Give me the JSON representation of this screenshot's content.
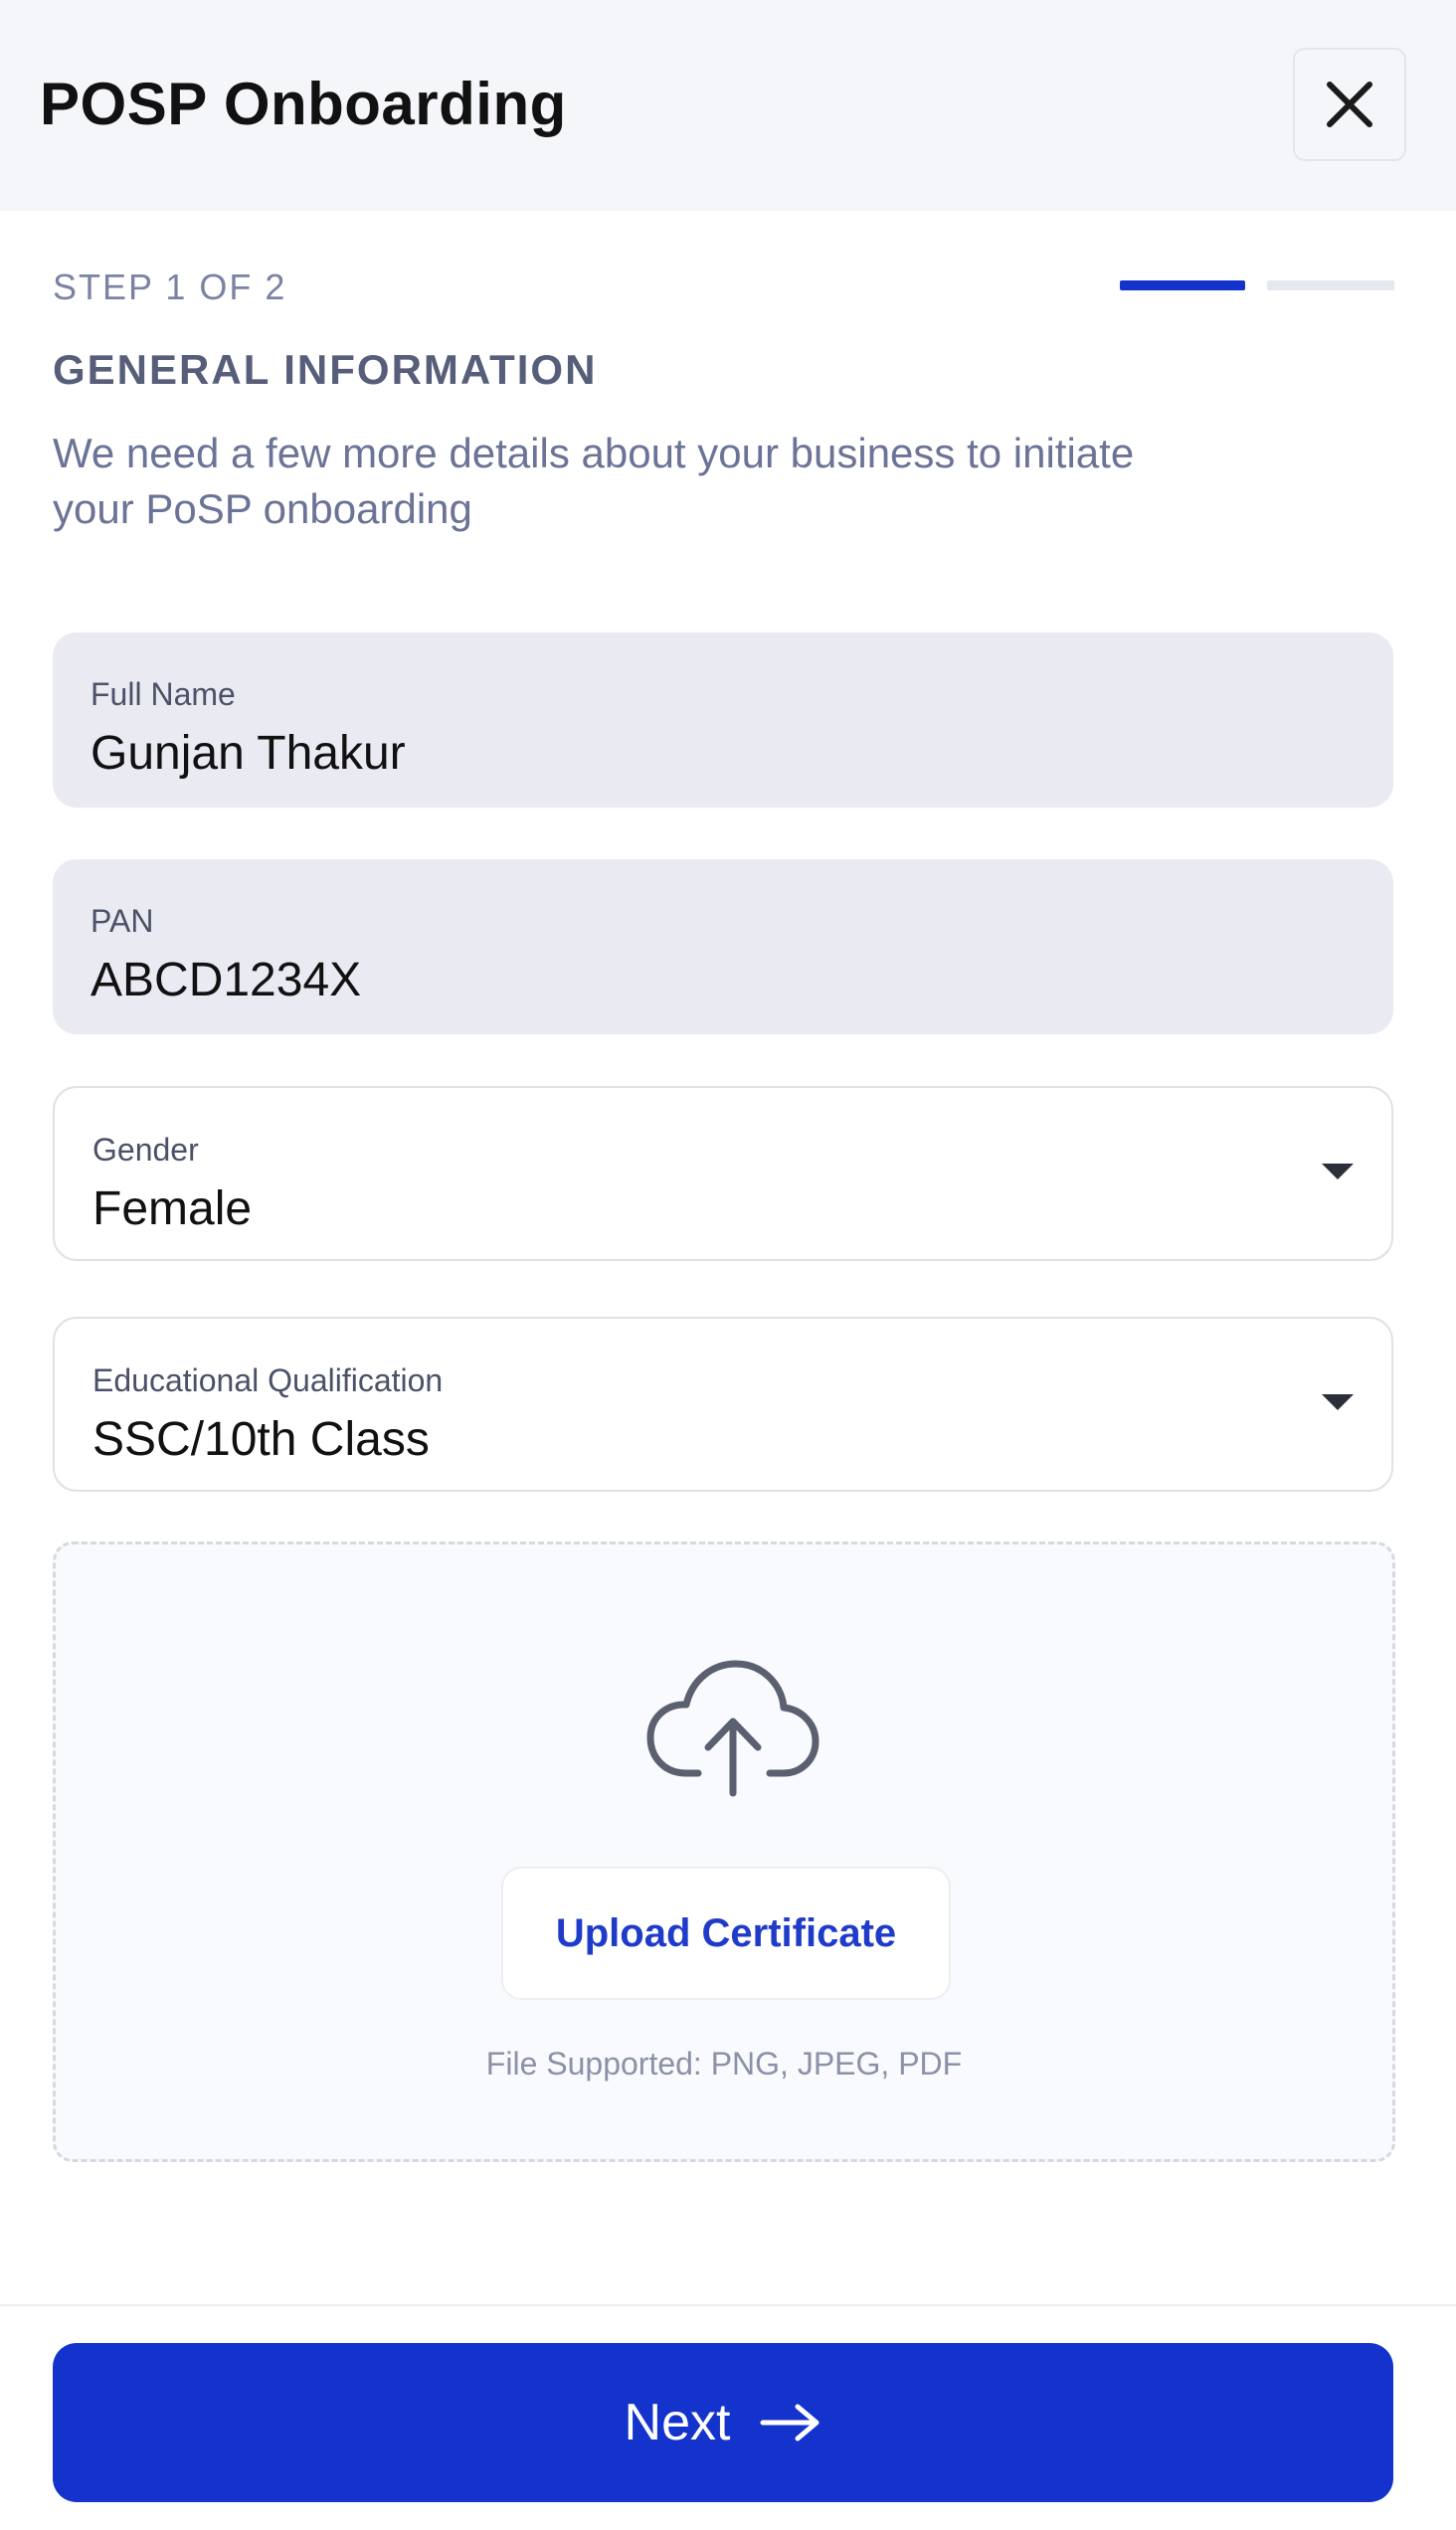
{
  "header": {
    "title": "POSP Onboarding"
  },
  "icons": {
    "close": "close-icon",
    "cloud_upload": "cloud-upload-icon",
    "arrow": "arrow-right-icon",
    "caret": "caret-down-icon"
  },
  "colors": {
    "accent": "#1433cc",
    "progress_inactive": "#e6e8ef",
    "field_filled_bg": "#eaebf2"
  },
  "step": {
    "label": "STEP 1 OF 2",
    "current": 1,
    "total": 2
  },
  "section": {
    "title": "GENERAL INFORMATION",
    "description": "We need a few more details about your business to initiate your PoSP onboarding"
  },
  "fields": {
    "full_name": {
      "label": "Full Name",
      "value": "Gunjan Thakur"
    },
    "pan": {
      "label": "PAN",
      "value": "ABCD1234X"
    },
    "gender": {
      "label": "Gender",
      "value": "Female"
    },
    "education": {
      "label": "Educational Qualification",
      "value": "SSC/10th Class"
    }
  },
  "upload": {
    "button_label": "Upload Certificate",
    "supported_text": "File Supported: PNG, JPEG, PDF"
  },
  "footer": {
    "next_label": "Next"
  }
}
